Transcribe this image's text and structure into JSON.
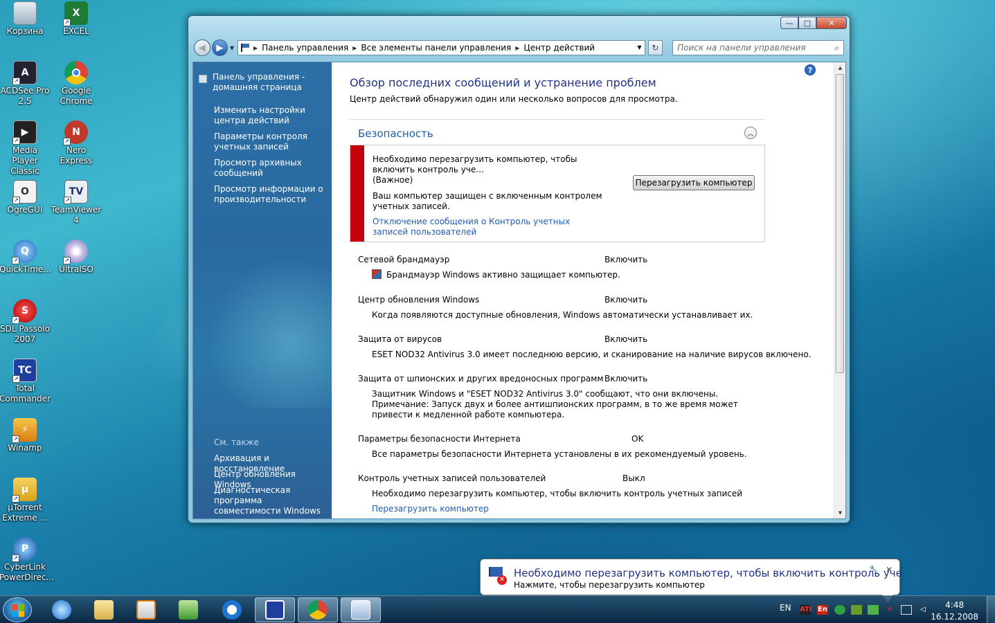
{
  "desktop": {
    "icons": [
      {
        "label": "Корзина",
        "icon": "recycle-bin-icon"
      },
      {
        "label": "EXCEL",
        "icon": "excel-icon"
      },
      {
        "label": "ACDSee Pro 2.5",
        "icon": "acdsee-icon"
      },
      {
        "label": "Google Chrome",
        "icon": "chrome-icon"
      },
      {
        "label": "Media Player Classic",
        "icon": "media-player-icon"
      },
      {
        "label": "Nero Express",
        "icon": "nero-icon"
      },
      {
        "label": "OgreGUI",
        "icon": "ogregui-icon"
      },
      {
        "label": "TeamViewer 4",
        "icon": "teamviewer-icon"
      },
      {
        "label": "QuickTime...",
        "icon": "quicktime-icon"
      },
      {
        "label": "UltraISO",
        "icon": "ultraiso-icon"
      },
      {
        "label": "SDL Passolo 2007",
        "icon": "passolo-icon"
      },
      {
        "label": "Total Commander",
        "icon": "total-commander-icon"
      },
      {
        "label": "Winamp",
        "icon": "winamp-icon"
      },
      {
        "label": "µTorrent Extreme ...",
        "icon": "utorrent-icon"
      },
      {
        "label": "CyberLink PowerDirec...",
        "icon": "powerdirector-icon"
      }
    ]
  },
  "window": {
    "caption_buttons": {
      "min": "—",
      "max": "□",
      "close": "✕"
    },
    "nav": {
      "back": "◀",
      "forward": "▶",
      "dropdown": "▼",
      "refresh": "↻"
    },
    "breadcrumbs": [
      "Панель управления",
      "Все элементы панели управления",
      "Центр действий"
    ],
    "search_placeholder": "Поиск на панели управления",
    "sidebar": {
      "home": "Панель управления - домашняя страница",
      "links": [
        "Изменить настройки центра действий",
        "Параметры контроля учетных записей",
        "Просмотр архивных сообщений",
        "Просмотр информации о производительности"
      ],
      "see_also_title": "См. также",
      "see_also": [
        "Архивация и восстановление",
        "Центр обновления Windows",
        "Диагностическая программа совместимости Windows"
      ]
    },
    "main": {
      "title": "Обзор последних сообщений и устранение проблем",
      "subtitle": "Центр действий обнаружил один или несколько вопросов для просмотра.",
      "section": "Безопасность",
      "alert": {
        "line1": "Необходимо перезагрузить компьютер, чтобы включить контроль уче...",
        "importance": "(Важное)",
        "desc": "Ваш компьютер защищен с включенным контролем учетных записей.",
        "link": "Отключение сообщения о Контроль учетных записей пользователей",
        "button": "Перезагрузить компьютер"
      },
      "items": [
        {
          "name": "Сетевой брандмауэр",
          "status": "Включить",
          "desc": "Брандмауэр Windows активно защищает компьютер."
        },
        {
          "name": "Центр обновления Windows",
          "status": "Включить",
          "desc": "Когда появляются доступные обновления, Windows автоматически устанавливает их."
        },
        {
          "name": "Защита от вирусов",
          "status": "Включить",
          "desc": "ESET NOD32 Antivirus 3.0 имеет последнюю версию, и сканирование на наличие вирусов включено."
        },
        {
          "name": "Защита от шпионских и других вредоносных программ",
          "status": "Включить",
          "desc": "Защитник Windows и \"ESET NOD32 Antivirus 3.0\" сообщают, что они включены.",
          "note": "Примечание: Запуск двух и более антишпионских программ, в то же время может привести к медленной работе компьютера."
        },
        {
          "name": "Параметры безопасности Интернета",
          "status": "OK",
          "desc": "Все параметры безопасности Интернета установлены в их рекомендуемый уровень."
        },
        {
          "name": "Контроль учетных записей пользователей",
          "status": "Выкл",
          "desc": "Необходимо перезагрузить компьютер, чтобы включить контроль учетных записей",
          "link": "Перезагрузить компьютер"
        }
      ]
    }
  },
  "balloon": {
    "title": "Необходимо перезагрузить компьютер, чтобы включить контроль уче",
    "subtitle": "Нажмите, чтобы перезагрузить компьютер"
  },
  "taskbar": {
    "lang": "EN",
    "time": "4:48",
    "date": "16.12.2008",
    "tray": [
      "ATI",
      "En"
    ]
  }
}
